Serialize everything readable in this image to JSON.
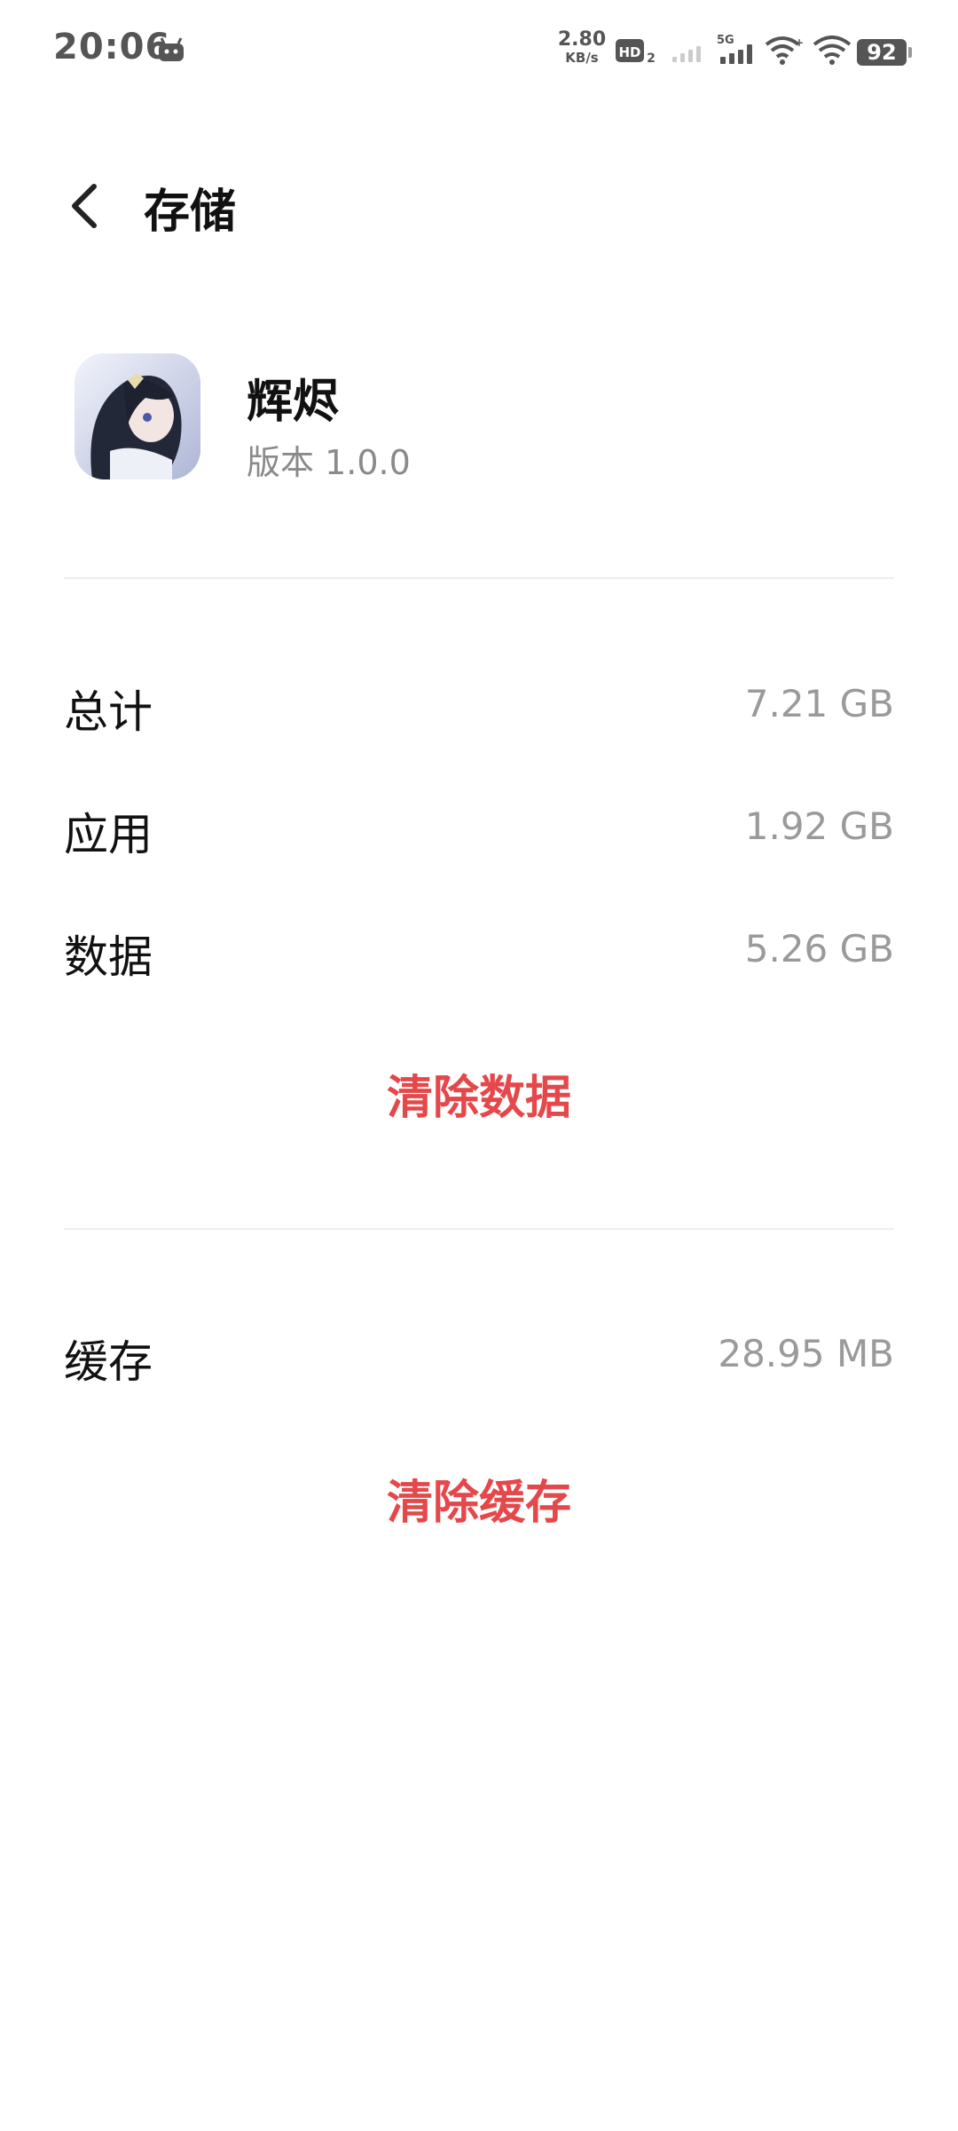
{
  "status_bar": {
    "time": "20:06",
    "net_speed_value": "2.80",
    "net_speed_unit": "KB/s",
    "hd_label": "HD",
    "hd_sub": "2",
    "network_type": "5G",
    "battery": "92"
  },
  "header": {
    "title": "存储"
  },
  "app": {
    "name": "辉烬",
    "version": "版本 1.0.0"
  },
  "storage": {
    "total_label": "总计",
    "total_value": "7.21 GB",
    "app_label": "应用",
    "app_value": "1.92 GB",
    "data_label": "数据",
    "data_value": "5.26 GB",
    "clear_data_label": "清除数据"
  },
  "cache": {
    "label": "缓存",
    "value": "28.95 MB",
    "clear_cache_label": "清除缓存"
  },
  "colors": {
    "accent_red": "#e5484a",
    "value_gray": "#9a9a9a"
  }
}
